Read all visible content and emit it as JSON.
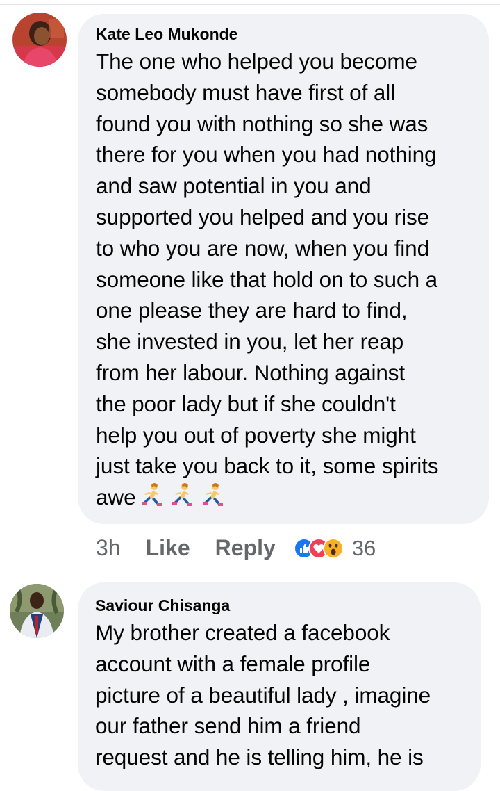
{
  "comments": [
    {
      "author": "Kate Leo Mukonde",
      "text": "The one who helped you become\nsomebody must have first of all\nfound you with nothing so she was\nthere for you when you had nothing\nand saw potential in you and\nsupported you helped and you rise\nto who you are now, when you find\nsomeone like that hold on to such a\none please they are hard to find,\nshe invested in you, let her reap\nfrom her labour. Nothing against\nthe poor lady but if she couldn't\nhelp you out of poverty she might\njust take you back to it, some spirits\nawe",
      "emoji": [
        "woman-running-emoji",
        "woman-running-emoji",
        "woman-running-emoji"
      ],
      "time": "3h",
      "like_label": "Like",
      "reply_label": "Reply",
      "reactions": [
        "like-reaction-icon",
        "love-reaction-icon",
        "wow-reaction-icon"
      ],
      "reaction_count": "36"
    },
    {
      "author": "Saviour Chisanga",
      "text": "My brother created a facebook\naccount with a female profile\npicture of a beautiful lady , imagine\nour father send him a friend\nrequest and he is telling him, he is"
    }
  ],
  "colors": {
    "bubble": "#f0f2f5",
    "like_blue": "#1877f2",
    "love_red": "#f33e58",
    "wow_yellow": "#f7b125",
    "meta_gray": "#65676b"
  }
}
